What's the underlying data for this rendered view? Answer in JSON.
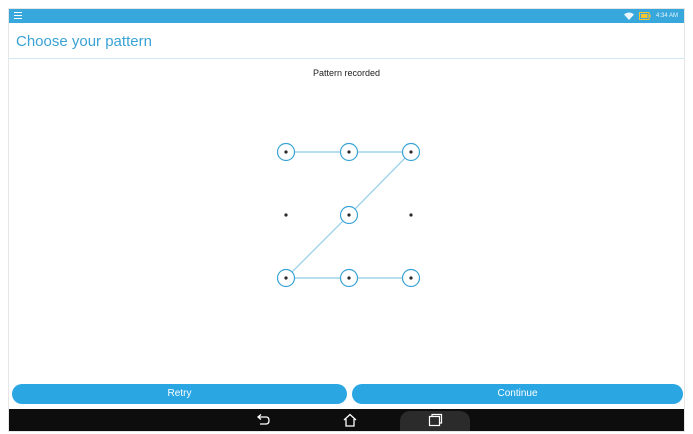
{
  "status_bar": {
    "time": "4:34 AM",
    "icons": [
      "menu-icon",
      "wifi-icon",
      "battery-icon"
    ],
    "color": "#38a8dc"
  },
  "header": {
    "title": "Choose your pattern"
  },
  "pattern": {
    "status_text": "Pattern recorded",
    "selected_dots": [
      1,
      2,
      3,
      5,
      7,
      8,
      9
    ],
    "path_order": [
      1,
      2,
      3,
      5,
      7,
      8,
      9
    ],
    "accent": "#3aa3d5"
  },
  "actions": {
    "retry_label": "Retry",
    "continue_label": "Continue",
    "button_color": "#2aa7e3"
  },
  "nav_bar": {
    "icons": [
      "back-icon",
      "home-icon",
      "recents-icon"
    ]
  }
}
